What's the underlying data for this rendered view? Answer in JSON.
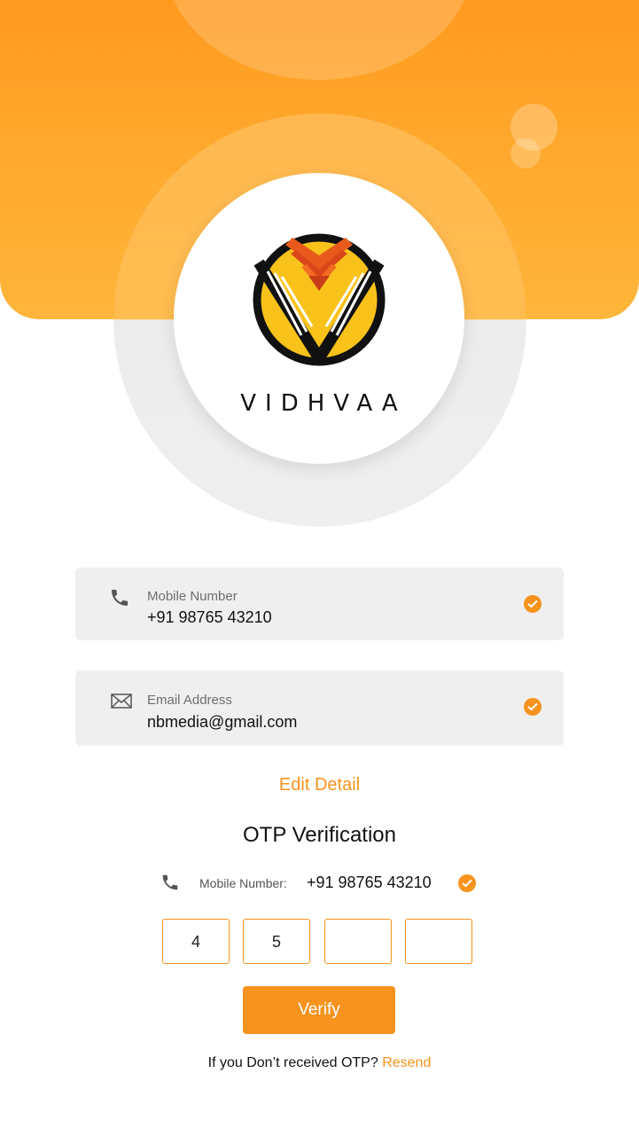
{
  "brand": {
    "name": "VIDHVAA"
  },
  "colors": {
    "accent": "#f7931e",
    "header": "#ff9f24",
    "field_bg": "#efefef"
  },
  "icons": {
    "phone": "phone-icon",
    "mail": "mail-icon",
    "check": "check-circle-icon"
  },
  "form": {
    "mobile": {
      "label": "Mobile Number",
      "value": "+91 98765 43210"
    },
    "email": {
      "label": "Email Address",
      "value": "nbmedia@gmail.com"
    },
    "edit_label": "Edit Detail"
  },
  "otp": {
    "title": "OTP Verification",
    "mobile_label": "Mobile Number:",
    "mobile_value": "+91 98765 43210",
    "digits": [
      "4",
      "5",
      "",
      ""
    ],
    "verify_label": "Verify",
    "resend_prompt": "If you Don’t received OTP?",
    "resend_label": "Resend"
  }
}
